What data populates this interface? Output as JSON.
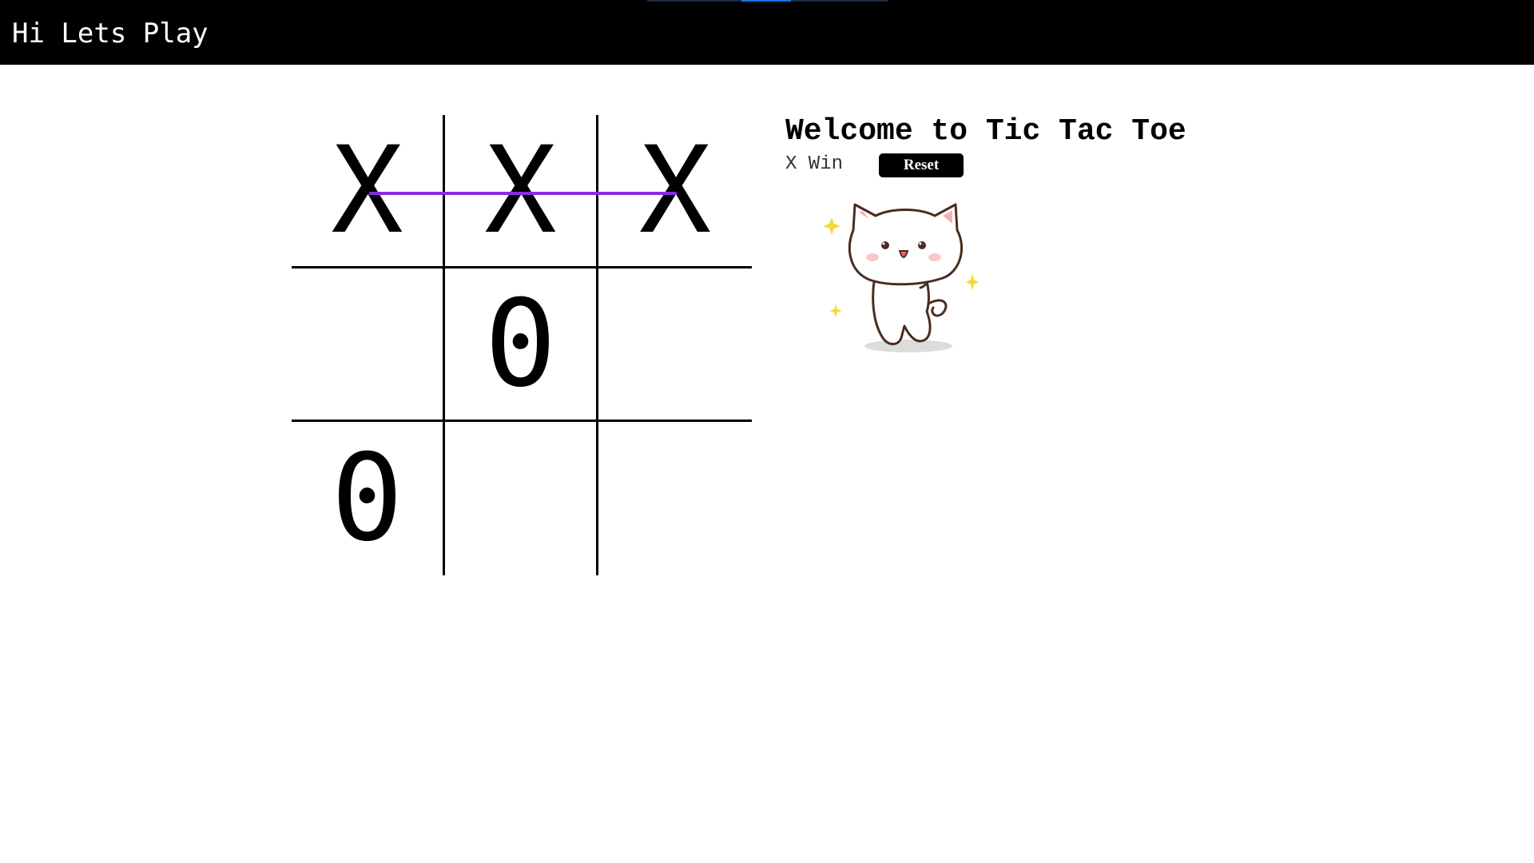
{
  "header": {
    "brand": "Hi Lets Play"
  },
  "game": {
    "title": "Welcome to Tic Tac Toe",
    "status": "X Win",
    "reset_label": "Reset",
    "board": [
      "X",
      "X",
      "X",
      "",
      "0",
      "",
      "0",
      "",
      ""
    ],
    "winning_line": "top-row",
    "win_line_color": "#8a2be2"
  },
  "illustration": {
    "name": "celebrating-cat-sticker"
  }
}
